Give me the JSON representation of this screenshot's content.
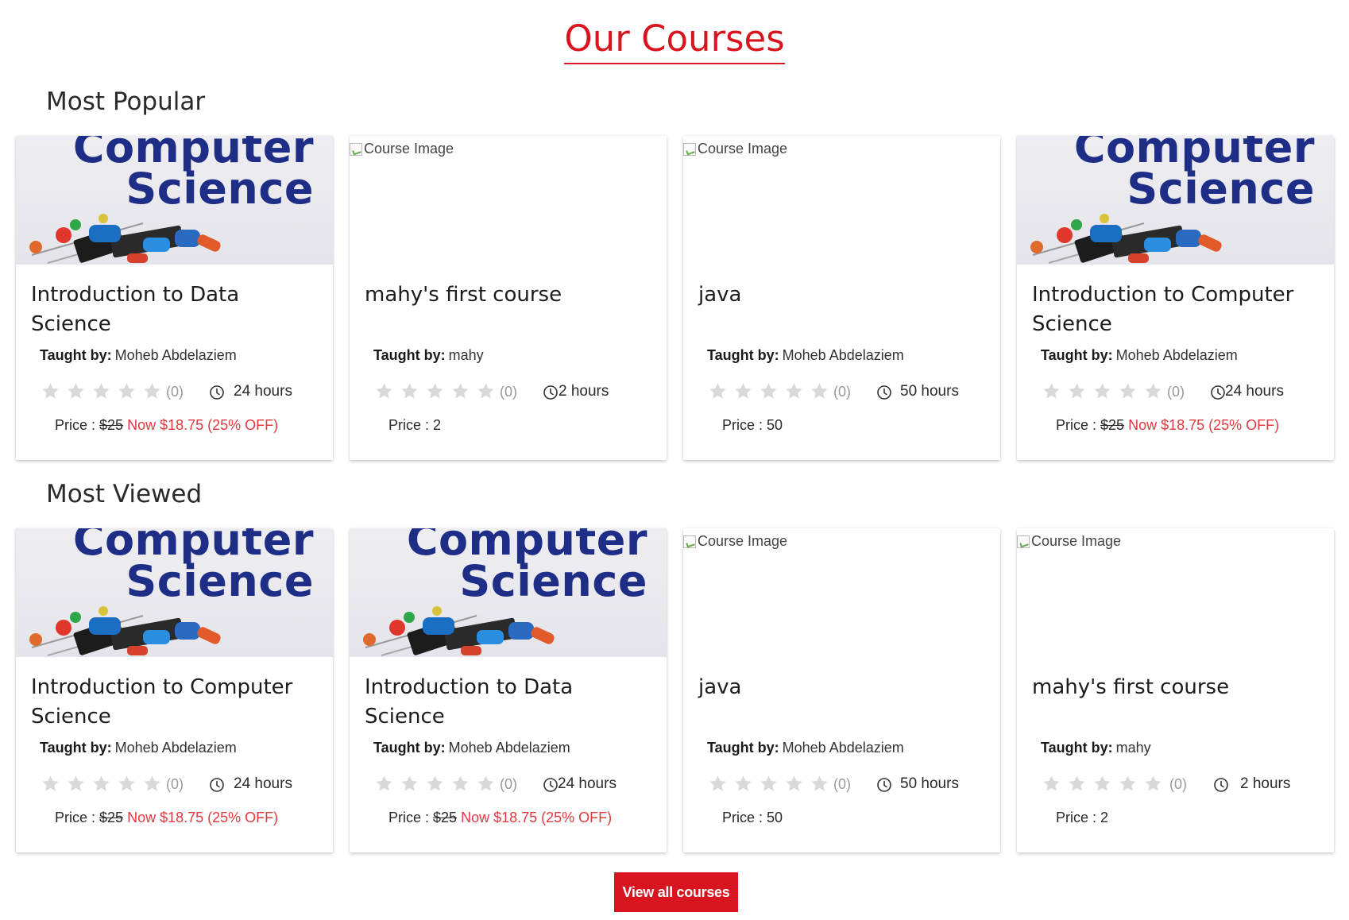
{
  "page_title": "Our Courses",
  "labels": {
    "taught_by": "Taught by:",
    "price_prefix": "Price : ",
    "broken_image_alt": "Course Image",
    "art_line1": "Computer",
    "art_line2": "Science"
  },
  "sections": [
    {
      "title": "Most Popular",
      "courses": [
        {
          "image": "computer-science",
          "title": "Introduction to Data Science",
          "instructor": "Moheb Abdelaziem",
          "rating_count": "(0)",
          "duration": "24 hours",
          "price_old": "$25",
          "price_now": "Now $18.75 (25% OFF)",
          "price_plain": ""
        },
        {
          "image": "broken",
          "title": "mahy's first course",
          "instructor": "mahy",
          "rating_count": "(0)",
          "duration": "2 hours",
          "price_old": "",
          "price_now": "",
          "price_plain": "2"
        },
        {
          "image": "broken",
          "title": "java",
          "instructor": "Moheb Abdelaziem",
          "rating_count": "(0)",
          "duration": "50 hours",
          "price_old": "",
          "price_now": "",
          "price_plain": "50"
        },
        {
          "image": "computer-science",
          "title": "Introduction to Computer Science",
          "instructor": "Moheb Abdelaziem",
          "rating_count": "(0)",
          "duration": "24 hours",
          "price_old": "$25",
          "price_now": "Now $18.75 (25% OFF)",
          "price_plain": ""
        }
      ]
    },
    {
      "title": "Most Viewed",
      "courses": [
        {
          "image": "computer-science",
          "title": "Introduction to Computer Science",
          "instructor": "Moheb Abdelaziem",
          "rating_count": "(0)",
          "duration": "24 hours",
          "price_old": "$25",
          "price_now": "Now $18.75 (25% OFF)",
          "price_plain": ""
        },
        {
          "image": "computer-science",
          "title": "Introduction to Data Science",
          "instructor": "Moheb Abdelaziem",
          "rating_count": "(0)",
          "duration": "24 hours",
          "price_old": "$25",
          "price_now": "Now $18.75 (25% OFF)",
          "price_plain": ""
        },
        {
          "image": "broken",
          "title": "java",
          "instructor": "Moheb Abdelaziem",
          "rating_count": "(0)",
          "duration": "50 hours",
          "price_old": "",
          "price_now": "",
          "price_plain": "50"
        },
        {
          "image": "broken",
          "title": "mahy's first course",
          "instructor": "mahy",
          "rating_count": "(0)",
          "duration": "2 hours",
          "price_old": "",
          "price_now": "",
          "price_plain": "2"
        }
      ]
    }
  ],
  "rating_stars": 0,
  "view_all_label": "View all courses",
  "colors": {
    "brand_red": "#d8141f",
    "discount_red": "#e0393e",
    "star_empty": "#d9d9d9",
    "art_text": "#1e2d86"
  }
}
